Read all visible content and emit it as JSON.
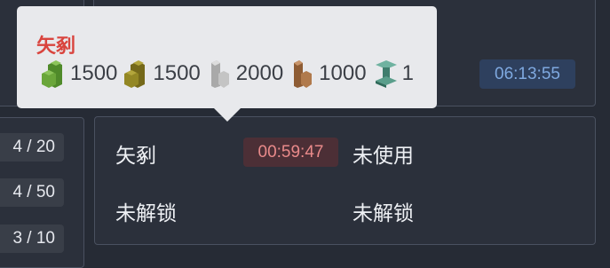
{
  "top_panel": {
    "timer": "06:13:55"
  },
  "left_column": {
    "counts": [
      "4 / 20",
      "4 / 50",
      "3 / 10"
    ]
  },
  "main_panel": {
    "slot1_label": "矢剢",
    "slot1_timer": "00:59:47",
    "slot2_label": "未使用",
    "slot3_label": "未解锁",
    "slot4_label": "未解锁"
  },
  "tooltip": {
    "title": "矢剢",
    "resources": [
      {
        "icon": "green-block-icon",
        "value": "1500",
        "color": "#5f9a33"
      },
      {
        "icon": "olive-block-icon",
        "value": "1500",
        "color": "#8a7f1e"
      },
      {
        "icon": "gray-block-icon",
        "value": "2000",
        "color": "#b7b7b7"
      },
      {
        "icon": "brown-block-icon",
        "value": "1000",
        "color": "#a36e43"
      },
      {
        "icon": "steel-beam-icon",
        "value": "1",
        "color": "#4f8f7e"
      }
    ]
  }
}
